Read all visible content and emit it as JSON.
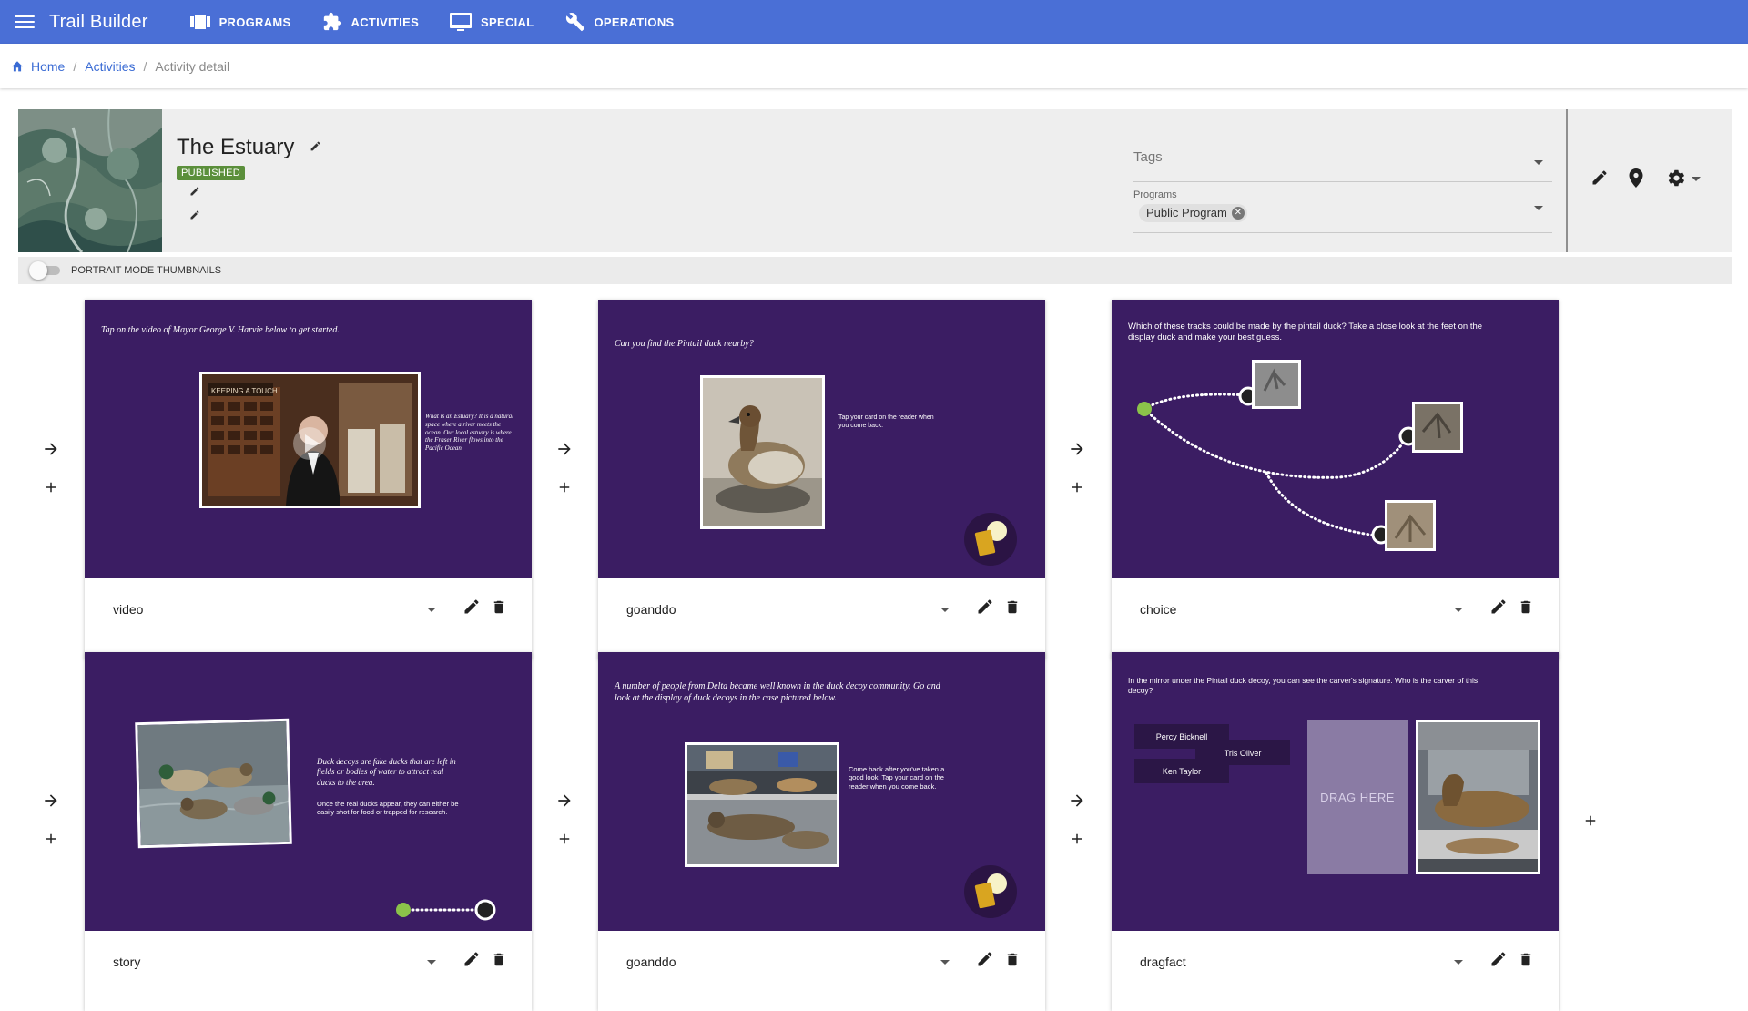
{
  "app": {
    "title": "Trail Builder"
  },
  "nav": [
    {
      "label": "PROGRAMS",
      "icon": "programs-icon"
    },
    {
      "label": "ACTIVITIES",
      "icon": "puzzle-icon"
    },
    {
      "label": "SPECIAL",
      "icon": "screen-icon"
    },
    {
      "label": "OPERATIONS",
      "icon": "wrench-icon"
    }
  ],
  "breadcrumb": {
    "home": "Home",
    "activities": "Activities",
    "current": "Activity detail",
    "separator": "/"
  },
  "activity": {
    "title": "The Estuary",
    "status": "PUBLISHED",
    "tags_label": "Tags",
    "programs_label": "Programs",
    "programs": [
      "Public Program"
    ]
  },
  "toggle": {
    "label": "PORTRAIT MODE THUMBNAILS",
    "on": false
  },
  "cards": [
    {
      "type": "video",
      "prompt": "Tap on the video of Mayor George V. Harvie below to get started.",
      "side_text": "What is an Estuary? It is a natural space where a river meets the ocean. Our local estuary is where the Fraser River flows into the Pacific Ocean.",
      "sign_text": "KEEPING A TOUCH"
    },
    {
      "type": "goanddo",
      "prompt": "Can you find the Pintail duck nearby?",
      "side_text": "Tap your card on the reader when you come back."
    },
    {
      "type": "choice",
      "prompt": "Which of these tracks could be made by the pintail duck? Take a close look at the feet on the display duck and make your best guess."
    },
    {
      "type": "story",
      "side_text_1": "Duck decoys are fake ducks that are left in fields or bodies of water to attract real ducks to the area.",
      "side_text_2": "Once the real ducks appear, they can either be easily shot for food or trapped for research."
    },
    {
      "type": "goanddo",
      "prompt": "A number of people from Delta became well known in the duck decoy community. Go and look at the display of duck decoys in the case pictured below.",
      "side_text": "Come back after you've taken a good look. Tap your card on the reader when you come back."
    },
    {
      "type": "dragfact",
      "prompt": "In the mirror under the Pintail duck decoy, you can see the carver's signature. Who is the carver of this decoy?",
      "options": [
        "Percy Bicknell",
        "Tris Oliver",
        "Ken Taylor"
      ],
      "drop_label": "DRAG HERE"
    }
  ],
  "colors": {
    "appbar": "#4a6fd6",
    "slide_bg": "#3b1d63",
    "published": "#5b8f3b",
    "link": "#3a6bd4",
    "path_start": "#8bc34a"
  }
}
